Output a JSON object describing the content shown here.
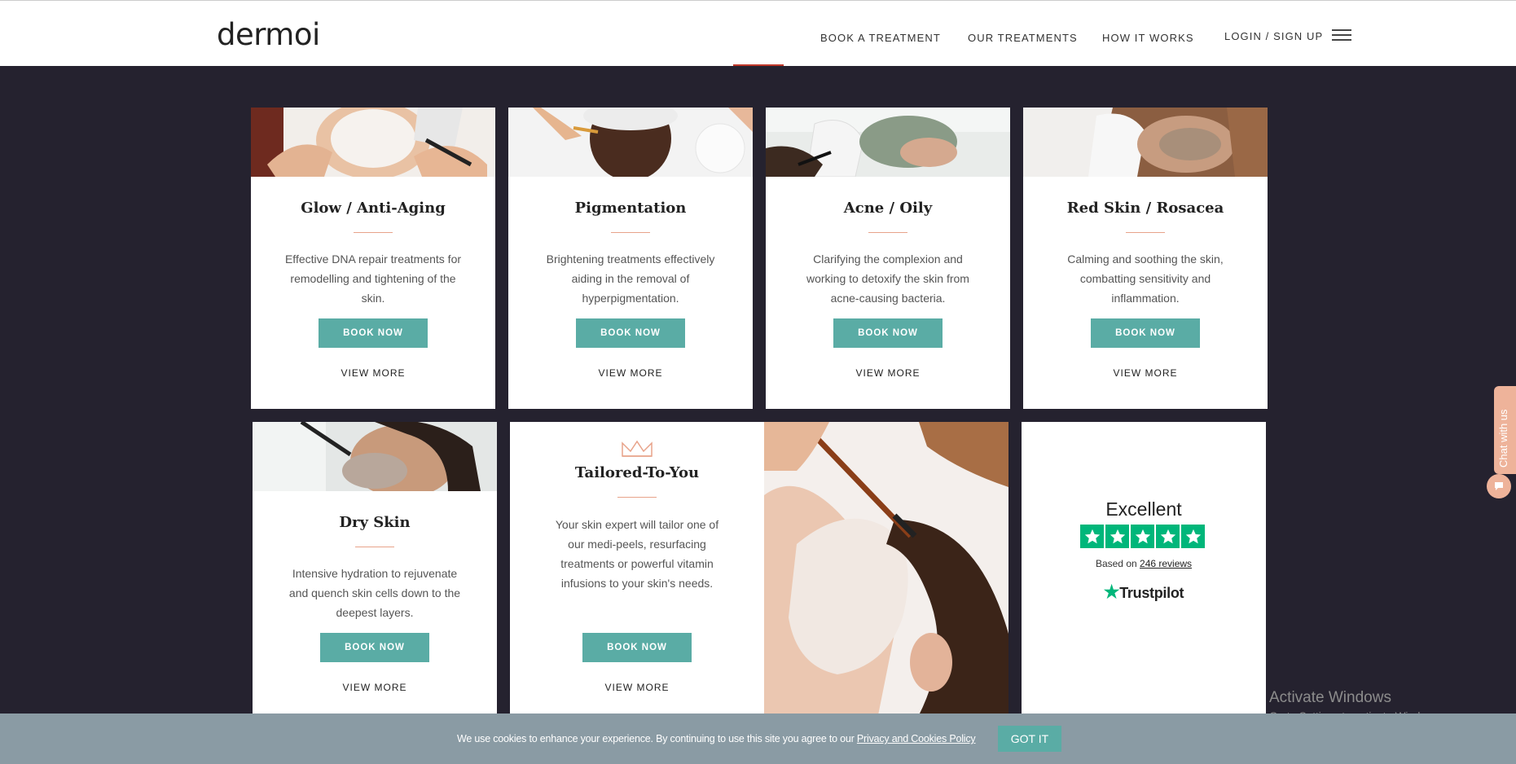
{
  "header": {
    "logo": "dermoi",
    "nav": [
      "BOOK A TREATMENT",
      "OUR TREATMENTS",
      "HOW IT WORKS",
      "LOGIN / SIGN UP"
    ]
  },
  "cards": [
    {
      "title": "Glow / Anti-Aging",
      "desc": "Effective DNA repair treatments for remodelling and tightening of the skin.",
      "book": "BOOK NOW",
      "more": "VIEW MORE"
    },
    {
      "title": "Pigmentation",
      "desc": "Brightening treatments effectively aiding in the removal of hyperpigmentation.",
      "book": "BOOK NOW",
      "more": "VIEW MORE"
    },
    {
      "title": "Acne / Oily",
      "desc": "Clarifying the complexion and working to detoxify the skin from acne-causing bacteria.",
      "book": "BOOK NOW",
      "more": "VIEW MORE"
    },
    {
      "title": "Red Skin / Rosacea",
      "desc": "Calming and soothing the skin, combatting sensitivity and inflammation.",
      "book": "BOOK NOW",
      "more": "VIEW MORE"
    },
    {
      "title": "Dry Skin",
      "desc": "Intensive hydration to rejuvenate and quench skin cells down to the deepest layers.",
      "book": "BOOK NOW",
      "more": "VIEW MORE"
    }
  ],
  "tailored": {
    "title": "Tailored-To-You",
    "desc": "Your skin expert will tailor one of our medi-peels, resurfacing treatments or powerful vitamin infusions to your skin's needs.",
    "book": "BOOK NOW",
    "more": "VIEW MORE"
  },
  "trustpilot": {
    "rating_word": "Excellent",
    "stars": 5,
    "based_on": "Based on",
    "reviews_link": "246 reviews",
    "brand": "Trustpilot"
  },
  "chat": {
    "label": "Chat with us"
  },
  "watermark": {
    "title": "Activate Windows",
    "subtitle": "Go to Settings to activate Windows."
  },
  "cookie": {
    "text": "We use cookies to enhance your experience. By continuing to use this site you agree to our ",
    "link": "Privacy and Cookies Policy",
    "button": "GOT IT"
  },
  "colors": {
    "teal": "#5aaca5",
    "navy_bg": "#25222f",
    "peach": "#e8a38a",
    "trustpilot_green": "#00b67a",
    "cookie_bar": "#8a9ba4"
  }
}
